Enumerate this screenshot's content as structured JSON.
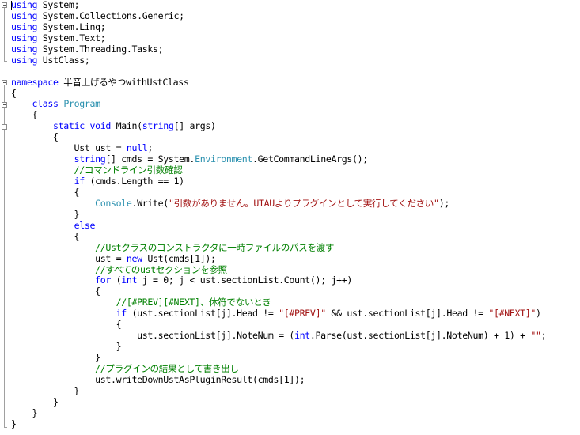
{
  "editor": {
    "language": "csharp",
    "lines": [
      [
        {
          "t": "using",
          "c": "kw"
        },
        {
          "t": " System;",
          "c": "tx"
        }
      ],
      [
        {
          "t": "using",
          "c": "kw"
        },
        {
          "t": " System.Collections.Generic;",
          "c": "tx"
        }
      ],
      [
        {
          "t": "using",
          "c": "kw"
        },
        {
          "t": " System.Linq;",
          "c": "tx"
        }
      ],
      [
        {
          "t": "using",
          "c": "kw"
        },
        {
          "t": " System.Text;",
          "c": "tx"
        }
      ],
      [
        {
          "t": "using",
          "c": "kw"
        },
        {
          "t": " System.Threading.Tasks;",
          "c": "tx"
        }
      ],
      [
        {
          "t": "using",
          "c": "kw"
        },
        {
          "t": " UstClass;",
          "c": "tx"
        }
      ],
      [],
      [
        {
          "t": "namespace",
          "c": "kw"
        },
        {
          "t": " 半音上げるやつwithUstClass",
          "c": "tx"
        }
      ],
      [
        {
          "t": "{",
          "c": "tx"
        }
      ],
      [
        {
          "t": "    ",
          "c": "tx"
        },
        {
          "t": "class",
          "c": "kw"
        },
        {
          "t": " ",
          "c": "tx"
        },
        {
          "t": "Program",
          "c": "ty"
        }
      ],
      [
        {
          "t": "    {",
          "c": "tx"
        }
      ],
      [
        {
          "t": "        ",
          "c": "tx"
        },
        {
          "t": "static",
          "c": "kw"
        },
        {
          "t": " ",
          "c": "tx"
        },
        {
          "t": "void",
          "c": "kw"
        },
        {
          "t": " Main(",
          "c": "tx"
        },
        {
          "t": "string",
          "c": "kw"
        },
        {
          "t": "[] args)",
          "c": "tx"
        }
      ],
      [
        {
          "t": "        {",
          "c": "tx"
        }
      ],
      [
        {
          "t": "            Ust ust = ",
          "c": "tx"
        },
        {
          "t": "null",
          "c": "kw"
        },
        {
          "t": ";",
          "c": "tx"
        }
      ],
      [
        {
          "t": "            ",
          "c": "tx"
        },
        {
          "t": "string",
          "c": "kw"
        },
        {
          "t": "[] cmds = System.",
          "c": "tx"
        },
        {
          "t": "Environment",
          "c": "ty"
        },
        {
          "t": ".GetCommandLineArgs();",
          "c": "tx"
        }
      ],
      [
        {
          "t": "            //コマンドライン引数確認",
          "c": "cm"
        }
      ],
      [
        {
          "t": "            ",
          "c": "tx"
        },
        {
          "t": "if",
          "c": "kw"
        },
        {
          "t": " (cmds.Length == 1)",
          "c": "tx"
        }
      ],
      [
        {
          "t": "            {",
          "c": "tx"
        }
      ],
      [
        {
          "t": "                ",
          "c": "tx"
        },
        {
          "t": "Console",
          "c": "ty"
        },
        {
          "t": ".Write(",
          "c": "tx"
        },
        {
          "t": "\"引数がありません。UTAUよりプラグインとして実行してください\"",
          "c": "st"
        },
        {
          "t": ");",
          "c": "tx"
        }
      ],
      [
        {
          "t": "            }",
          "c": "tx"
        }
      ],
      [
        {
          "t": "            ",
          "c": "tx"
        },
        {
          "t": "else",
          "c": "kw"
        }
      ],
      [
        {
          "t": "            {",
          "c": "tx"
        }
      ],
      [
        {
          "t": "                //Ustクラスのコンストラクタに一時ファイルのパスを渡す",
          "c": "cm"
        }
      ],
      [
        {
          "t": "                ust = ",
          "c": "tx"
        },
        {
          "t": "new",
          "c": "kw"
        },
        {
          "t": " Ust(cmds[1]);",
          "c": "tx"
        }
      ],
      [
        {
          "t": "                //すべてのustセクションを参照",
          "c": "cm"
        }
      ],
      [
        {
          "t": "                ",
          "c": "tx"
        },
        {
          "t": "for",
          "c": "kw"
        },
        {
          "t": " (",
          "c": "tx"
        },
        {
          "t": "int",
          "c": "kw"
        },
        {
          "t": " j = 0; j < ust.sectionList.Count(); j++)",
          "c": "tx"
        }
      ],
      [
        {
          "t": "                {",
          "c": "tx"
        }
      ],
      [
        {
          "t": "                    //[#PREV][#NEXT]、休符でないとき",
          "c": "cm"
        }
      ],
      [
        {
          "t": "                    ",
          "c": "tx"
        },
        {
          "t": "if",
          "c": "kw"
        },
        {
          "t": " (ust.sectionList[j].Head != ",
          "c": "tx"
        },
        {
          "t": "\"[#PREV]\"",
          "c": "st"
        },
        {
          "t": " && ust.sectionList[j].Head != ",
          "c": "tx"
        },
        {
          "t": "\"[#NEXT]\"",
          "c": "st"
        },
        {
          "t": ")",
          "c": "tx"
        }
      ],
      [
        {
          "t": "                    {",
          "c": "tx"
        }
      ],
      [
        {
          "t": "                        ust.sectionList[j].NoteNum = (",
          "c": "tx"
        },
        {
          "t": "int",
          "c": "kw"
        },
        {
          "t": ".Parse(ust.sectionList[j].NoteNum) + 1) + ",
          "c": "tx"
        },
        {
          "t": "\"\"",
          "c": "st"
        },
        {
          "t": ";",
          "c": "tx"
        }
      ],
      [
        {
          "t": "                    }",
          "c": "tx"
        }
      ],
      [
        {
          "t": "                }",
          "c": "tx"
        }
      ],
      [
        {
          "t": "                //プラグインの結果として書き出し",
          "c": "cm"
        }
      ],
      [
        {
          "t": "                ust.writeDownUstAsPluginResult(cmds[1]);",
          "c": "tx"
        }
      ],
      [
        {
          "t": "            }",
          "c": "tx"
        }
      ],
      [
        {
          "t": "        }",
          "c": "tx"
        }
      ],
      [
        {
          "t": "    }",
          "c": "tx"
        }
      ],
      [
        {
          "t": "}",
          "c": "tx"
        }
      ]
    ]
  },
  "colors": {
    "keyword": "#0000ff",
    "type": "#2b91af",
    "comment": "#008000",
    "string": "#a31515",
    "text": "#000000",
    "outline": "#a0a0a0"
  }
}
